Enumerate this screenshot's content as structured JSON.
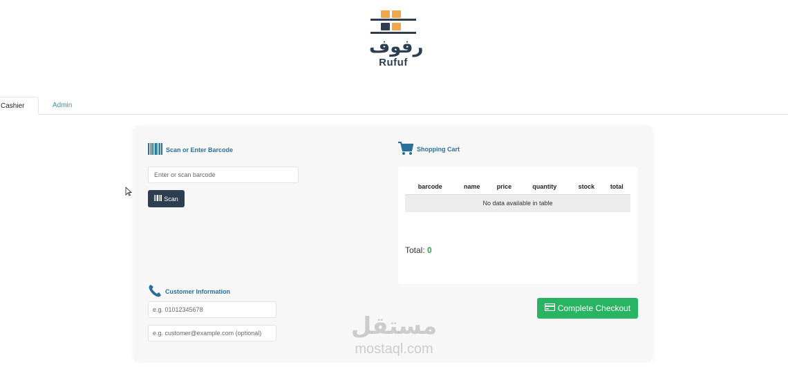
{
  "brand": {
    "name_ar": "رفوف",
    "name_en": "Rufuf",
    "box_color": "#f0a64a",
    "ink_color": "#2c3e50"
  },
  "tabs": [
    {
      "label": "Cashier",
      "active": true
    },
    {
      "label": "Admin",
      "active": false
    }
  ],
  "scan": {
    "title": "Scan or Enter Barcode",
    "icon": "barcode-icon",
    "placeholder": "Enter or scan barcode",
    "button_label": "Scan"
  },
  "cart": {
    "title": "Shopping Cart",
    "icon": "cart-icon",
    "columns": [
      "barcode",
      "name",
      "price",
      "quantity",
      "stock",
      "total"
    ],
    "empty_message": "No data available in table",
    "total_label": "Total:",
    "total_value": "0"
  },
  "customer": {
    "title": "Customer Information",
    "icon": "phone-icon",
    "phone_placeholder": "e.g. 01012345678",
    "email_placeholder": "e.g. customer@example.com (optional)"
  },
  "checkout": {
    "label": "Complete Checkout",
    "icon": "credit-card-icon",
    "color": "#28b463"
  },
  "watermark": {
    "ar": "مستقل",
    "en": "mostaql.com"
  }
}
